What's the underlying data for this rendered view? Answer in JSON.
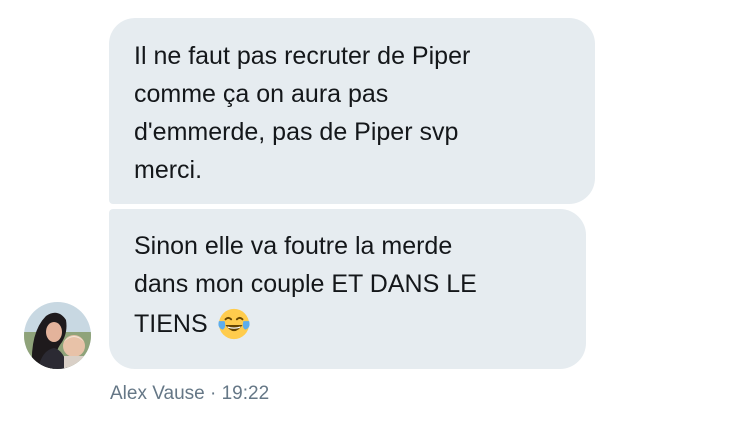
{
  "messages": [
    {
      "text": "Il ne faut pas recruter de Piper\ncomme ça on aura pas\nd'emmerde, pas de Piper svp\nmerci."
    },
    {
      "lines": [
        "Sinon elle va foutre la merde",
        "dans mon couple ET DANS LE",
        "TIENS"
      ],
      "emoji": "face-with-tears-of-joy"
    }
  ],
  "sender": {
    "name": "Alex Vause",
    "separator": "·",
    "time": "19:22"
  },
  "colors": {
    "bubble": "#e6ecf0",
    "text": "#14171a",
    "meta": "#657786"
  }
}
